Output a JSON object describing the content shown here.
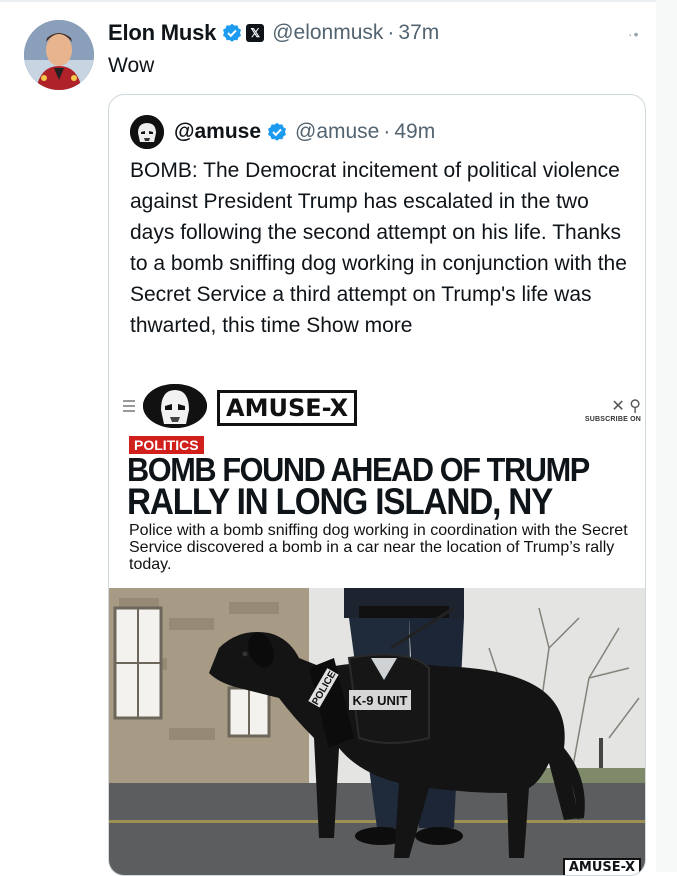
{
  "tweet": {
    "author_name": "Elon Musk",
    "handle": "@elonmusk",
    "separator": "·",
    "time": "37m",
    "text": "Wow",
    "verified_icon": "verified-badge-icon",
    "x_icon": "x-logo-icon",
    "more_icon": "more-dots-icon"
  },
  "quoted": {
    "author_name": "@amuse",
    "handle": "@amuse",
    "separator": "·",
    "time": "49m",
    "text": "BOMB: The Democrat incitement of political violence against President Trump has escalated in the two days following the second attempt on his life. Thanks to a bomb sniffing dog working in conjunction with the Secret Service a third attempt on Trump's life was thwarted, this time",
    "show_more": "Show more"
  },
  "media": {
    "brand": "AMUSE-X",
    "subscribe_label": "SUBSCRIBE ON",
    "category": "POLITICS",
    "headline_line1": "BOMB FOUND AHEAD OF TRUMP",
    "headline_line2": "RALLY IN LONG ISLAND, NY",
    "summary": "Police with a bomb sniffing dog working in coordination with the Secret Service discovered a bomb in a car near the location of Trump’s rally today.",
    "vest_text": "POLICE",
    "vest_unit": "K-9 UNIT",
    "watermark": "AMUSE-X"
  },
  "colors": {
    "verified_blue": "#1d9bf0",
    "category_red": "#d1201b",
    "secondary_text": "#536471"
  }
}
